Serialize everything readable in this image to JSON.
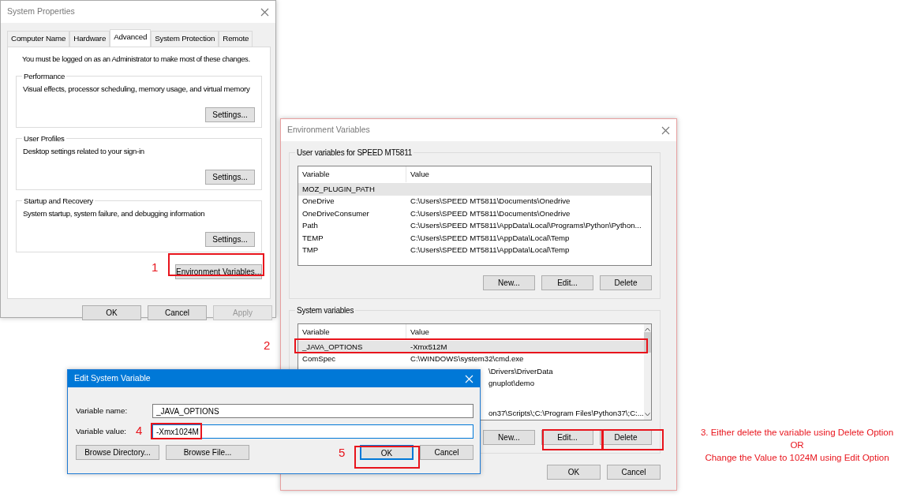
{
  "system_properties": {
    "title": "System Properties",
    "tabs": [
      {
        "label": "Computer Name",
        "selected": false
      },
      {
        "label": "Hardware",
        "selected": false
      },
      {
        "label": "Advanced",
        "selected": true
      },
      {
        "label": "System Protection",
        "selected": false
      },
      {
        "label": "Remote",
        "selected": false
      }
    ],
    "admin_note": "You must be logged on as an Administrator to make most of these changes.",
    "groups": [
      {
        "title": "Performance",
        "description": "Visual effects, processor scheduling, memory usage, and virtual memory",
        "button": "Settings..."
      },
      {
        "title": "User Profiles",
        "description": "Desktop settings related to your sign-in",
        "button": "Settings..."
      },
      {
        "title": "Startup and Recovery",
        "description": "System startup, system failure, and debugging information",
        "button": "Settings..."
      }
    ],
    "env_button": "Environment Variables...",
    "buttons": [
      {
        "label": "OK",
        "disabled": false
      },
      {
        "label": "Cancel",
        "disabled": false
      },
      {
        "label": "Apply",
        "disabled": true
      }
    ]
  },
  "environment_variables": {
    "title": "Environment Variables",
    "user_group": {
      "title": "User variables for SPEED MT5811",
      "columns": [
        "Variable",
        "Value"
      ],
      "rows": [
        {
          "kind": "full",
          "variable": "MOZ_PLUGIN_PATH",
          "value": "",
          "selected": true
        },
        {
          "kind": "full",
          "variable": "OneDrive",
          "value": "C:\\Users\\SPEED MT5811\\Documents\\Onedrive",
          "selected": false
        },
        {
          "kind": "full",
          "variable": "OneDriveConsumer",
          "value": "C:\\Users\\SPEED MT5811\\Documents\\Onedrive",
          "selected": false
        },
        {
          "kind": "full",
          "variable": "Path",
          "value": "C:\\Users\\SPEED MT5811\\AppData\\Local\\Programs\\Python\\Python...",
          "selected": false
        },
        {
          "kind": "full",
          "variable": "TEMP",
          "value": "C:\\Users\\SPEED MT5811\\AppData\\Local\\Temp",
          "selected": false
        },
        {
          "kind": "full",
          "variable": "TMP",
          "value": "C:\\Users\\SPEED MT5811\\AppData\\Local\\Temp",
          "selected": false
        }
      ],
      "buttons": [
        "New...",
        "Edit...",
        "Delete"
      ]
    },
    "system_group": {
      "title": "System variables",
      "columns": [
        "Variable",
        "Value"
      ],
      "rows": [
        {
          "kind": "full",
          "variable": "_JAVA_OPTIONS",
          "value": "-Xmx512M",
          "selected": true
        },
        {
          "kind": "full",
          "variable": "ComSpec",
          "value": "C:\\WINDOWS\\system32\\cmd.exe",
          "selected": false
        },
        {
          "kind": "partial",
          "value": "\\Drivers\\DriverData",
          "selected": false
        },
        {
          "kind": "partial",
          "value": "gnuplot\\demo",
          "selected": false
        },
        {
          "kind": "partial",
          "value": "on37\\Scripts\\;C:\\Program Files\\Python37\\;C:...",
          "selected": false
        }
      ],
      "buttons": [
        "New...",
        "Edit...",
        "Delete"
      ]
    },
    "buttons": [
      "OK",
      "Cancel"
    ]
  },
  "edit_dialog": {
    "title": "Edit System Variable",
    "name_label": "Variable name:",
    "name_value": "_JAVA_OPTIONS",
    "value_label": "Variable value:",
    "value_value": "-Xmx1024M",
    "buttons": [
      {
        "label": "Browse Directory...",
        "default": false
      },
      {
        "label": "Browse File...",
        "default": false
      },
      {
        "label": "OK",
        "default": true
      },
      {
        "label": "Cancel",
        "default": false
      }
    ]
  },
  "step_numbers": [
    "1",
    "2",
    "4",
    "5"
  ],
  "note": [
    "3. Either delete the variable using Delete Option",
    "OR",
    "Change the Value to 1024M using Edit Option"
  ]
}
